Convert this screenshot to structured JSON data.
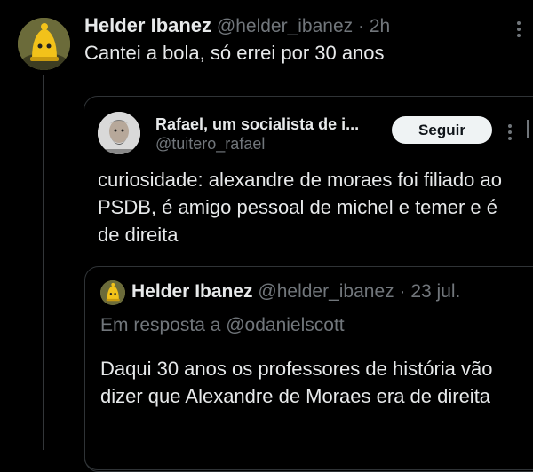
{
  "main_tweet": {
    "author_name": "Helder Ibanez",
    "handle": "@helder_ibanez",
    "separator": "·",
    "time": "2h",
    "text": "Cantei a bola, só errei por 30 anos"
  },
  "quoted_tweet": {
    "author_name": "Rafael, um socialista de i...",
    "handle": "@tuitero_rafael",
    "follow_label": "Seguir",
    "text": "curiosidade: alexandre de moraes foi filiado ao PSDB, é amigo pessoal de michel e temer e é de direita"
  },
  "nested_quote": {
    "author_name": "Helder Ibanez",
    "handle": "@helder_ibanez",
    "separator": "·",
    "time": "23 jul.",
    "reply_to": "Em resposta a @odanielscott",
    "text": "Daqui 30 anos os professores de história vão dizer que Alexandre de Moraes era de direita"
  },
  "colors": {
    "background": "#000000",
    "text": "#e7e9ea",
    "muted": "#71767b",
    "border": "#2f3336",
    "button_bg": "#eff3f4"
  },
  "icons": {
    "main_avatar": "yellow-bell-avatar",
    "rafael_avatar": "bearded-man-avatar",
    "more": "more-options-icon"
  }
}
